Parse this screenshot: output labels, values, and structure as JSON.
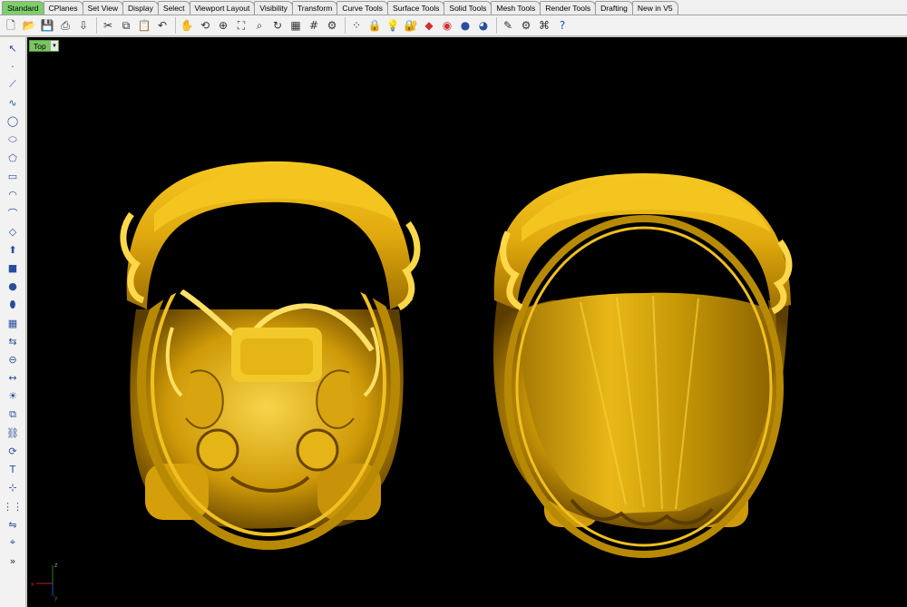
{
  "tabs": [
    "Standard",
    "CPlanes",
    "Set View",
    "Display",
    "Select",
    "Viewport Layout",
    "Visibility",
    "Transform",
    "Curve Tools",
    "Surface Tools",
    "Solid Tools",
    "Mesh Tools",
    "Render Tools",
    "Drafting",
    "New in V5"
  ],
  "active_tab": "Standard",
  "toolbar_icons": [
    "new-file-icon",
    "open-folder-icon",
    "save-icon",
    "print-icon",
    "import-icon",
    "cut-icon",
    "copy-icon",
    "paste-icon",
    "undo-icon",
    "pan-hand-icon",
    "rotate-view-icon",
    "zoom-window-icon",
    "zoom-extents-icon",
    "zoom-selected-icon",
    "rotate-icon",
    "viewport-layout-icon",
    "grid-snap-icon",
    "object-properties-icon",
    "select-points-icon",
    "lock-icon",
    "bulb-light-icon",
    "padlock-icon",
    "material-icon",
    "color-wheel-icon",
    "sphere-render-icon",
    "rendered-sphere-icon",
    "options-icon",
    "gear-tools-icon",
    "command-history-icon",
    "help-icon"
  ],
  "left_tools": [
    "select-arrow-icon",
    "point-icon",
    "polyline-icon",
    "curve-icon",
    "circle-icon",
    "ellipse-icon",
    "polygon-icon",
    "rectangle-icon",
    "arc-icon",
    "fillet-icon",
    "surface-icon",
    "extrude-icon",
    "box-solid-icon",
    "sphere-solid-icon",
    "cylinder-solid-icon",
    "mesh-icon",
    "transform-icon",
    "boolean-icon",
    "dimension-icon",
    "lights-icon",
    "group-icon",
    "join-icon",
    "rebuild-icon",
    "text-icon",
    "snap-icon",
    "array-icon",
    "mirror-icon",
    "analyze-icon",
    "expand-more-icon"
  ],
  "viewport": {
    "label": "Top",
    "dropdown_glyph": "▼"
  },
  "axes": {
    "x_label": "x",
    "y_label": "y",
    "z_label": "z"
  },
  "colors": {
    "model_gold": "#d9a80c",
    "viewport_bg": "#000000",
    "active_tab": "#7ccf6a"
  }
}
